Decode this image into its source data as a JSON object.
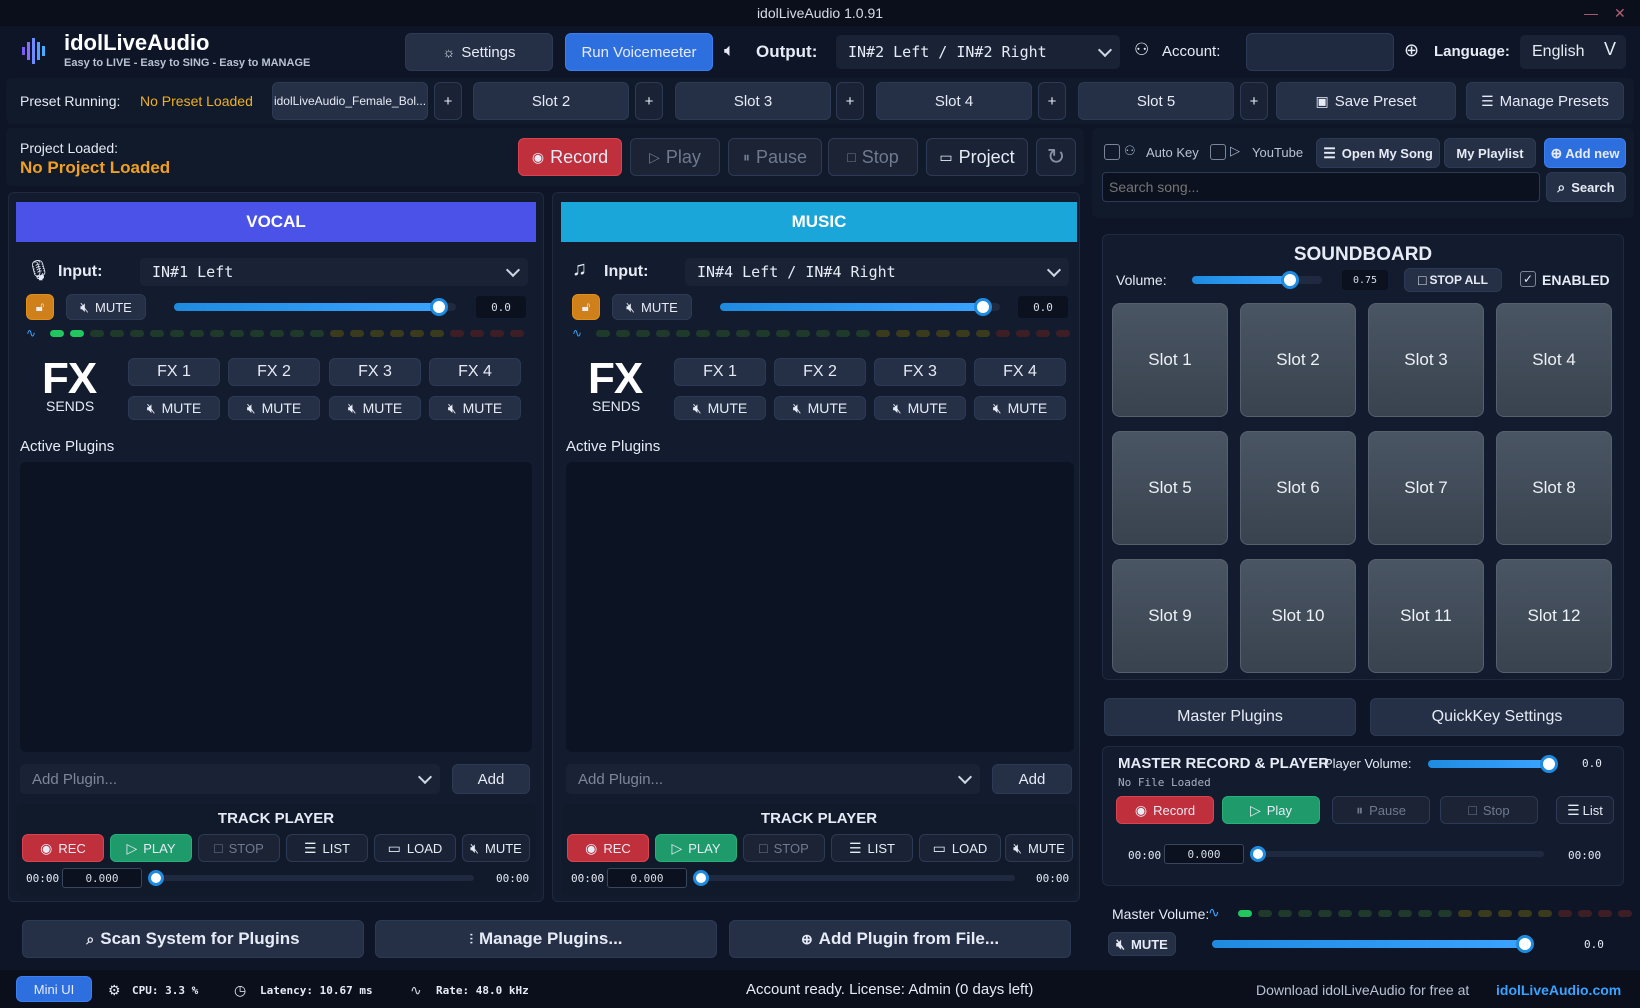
{
  "window": {
    "title": "idolLiveAudio 1.0.91"
  },
  "brand": {
    "name": "idolLiveAudio",
    "tagline": "Easy to LIVE - Easy to SING - Easy to MANAGE"
  },
  "topbar": {
    "settings": "Settings",
    "run_voicemeeter": "Run Voicemeeter",
    "output_label": "Output:",
    "output_value": "IN#2 Left / IN#2 Right",
    "account_label": "Account:",
    "account_value": "",
    "language_label": "Language:",
    "language_value": "English"
  },
  "presets": {
    "running_label": "Preset Running:",
    "running_value": "No Preset Loaded",
    "slots": [
      "idolLiveAudio_Female_Bol...",
      "Slot 2",
      "Slot 3",
      "Slot 4",
      "Slot 5"
    ],
    "plus": "+",
    "save": "Save Preset",
    "manage": "Manage Presets"
  },
  "project": {
    "label": "Project Loaded:",
    "value": "No Project Loaded",
    "record": "Record",
    "play": "Play",
    "pause": "Pause",
    "stop": "Stop",
    "project": "Project"
  },
  "vocal": {
    "title": "VOCAL",
    "input_label": "Input:",
    "input_value": "IN#1 Left",
    "mute": "MUTE",
    "level": "0.0",
    "fx_big": "FX",
    "fx_sends": "SENDS",
    "fx": [
      "FX 1",
      "FX 2",
      "FX 3",
      "FX 4"
    ],
    "active_plugins": "Active Plugins",
    "add_placeholder": "Add Plugin...",
    "add": "Add",
    "track_player": "TRACK PLAYER",
    "rec": "REC",
    "play": "PLAY",
    "stop": "STOP",
    "list": "LIST",
    "load": "LOAD",
    "t_start": "00:00",
    "t_val": "0.000",
    "t_end": "00:00"
  },
  "music": {
    "title": "MUSIC",
    "input_label": "Input:",
    "input_value": "IN#4 Left / IN#4 Right",
    "mute": "MUTE",
    "level": "0.0",
    "fx_big": "FX",
    "fx_sends": "SENDS",
    "fx": [
      "FX 1",
      "FX 2",
      "FX 3",
      "FX 4"
    ],
    "active_plugins": "Active Plugins",
    "add_placeholder": "Add Plugin...",
    "add": "Add",
    "track_player": "TRACK PLAYER",
    "rec": "REC",
    "play": "PLAY",
    "stop": "STOP",
    "list": "LIST",
    "load": "LOAD",
    "t_start": "00:00",
    "t_val": "0.000",
    "t_end": "00:00"
  },
  "bottom": {
    "scan": "Scan System for Plugins",
    "manage": "Manage Plugins...",
    "addfile": "Add Plugin from File..."
  },
  "songs": {
    "autokey": "Auto Key",
    "youtube": "YouTube",
    "open": "Open My Song",
    "playlist": "My Playlist",
    "addnew": "Add new",
    "search_placeholder": "Search song...",
    "search": "Search"
  },
  "soundboard": {
    "title": "SOUNDBOARD",
    "volume_label": "Volume:",
    "volume_value": "0.75",
    "volume_level": 0.75,
    "stop_all": "STOP ALL",
    "enabled": "ENABLED",
    "slots": [
      "Slot 1",
      "Slot 2",
      "Slot 3",
      "Slot 4",
      "Slot 5",
      "Slot 6",
      "Slot 7",
      "Slot 8",
      "Slot 9",
      "Slot 10",
      "Slot 11",
      "Slot 12"
    ]
  },
  "master": {
    "plugins": "Master Plugins",
    "quickkey": "QuickKey Settings",
    "title": "MASTER RECORD & PLAYER",
    "player_volume_label": "Player Volume:",
    "player_volume_value": "0.0",
    "file": "No File Loaded",
    "record": "Record",
    "play": "Play",
    "pause": "Pause",
    "stop": "Stop",
    "list": "List",
    "t_start": "00:00",
    "t_val": "0.000",
    "t_end": "00:00",
    "volume_label": "Master Volume:",
    "mute": "MUTE",
    "volume_value": "0.0"
  },
  "status": {
    "mini": "Mini UI",
    "cpu": "CPU: 3.3 %",
    "latency": "Latency: 10.67 ms",
    "rate": "Rate: 48.0 kHz",
    "account": "Account ready. License: Admin (0 days left)",
    "download": "Download idolLiveAudio for free at",
    "site": "idolLiveAudio.com"
  },
  "colors": {
    "vocal": "#4a52e8",
    "music": "#1aa6d8",
    "accent": "#2e6fe0",
    "warn": "#f0b020"
  }
}
